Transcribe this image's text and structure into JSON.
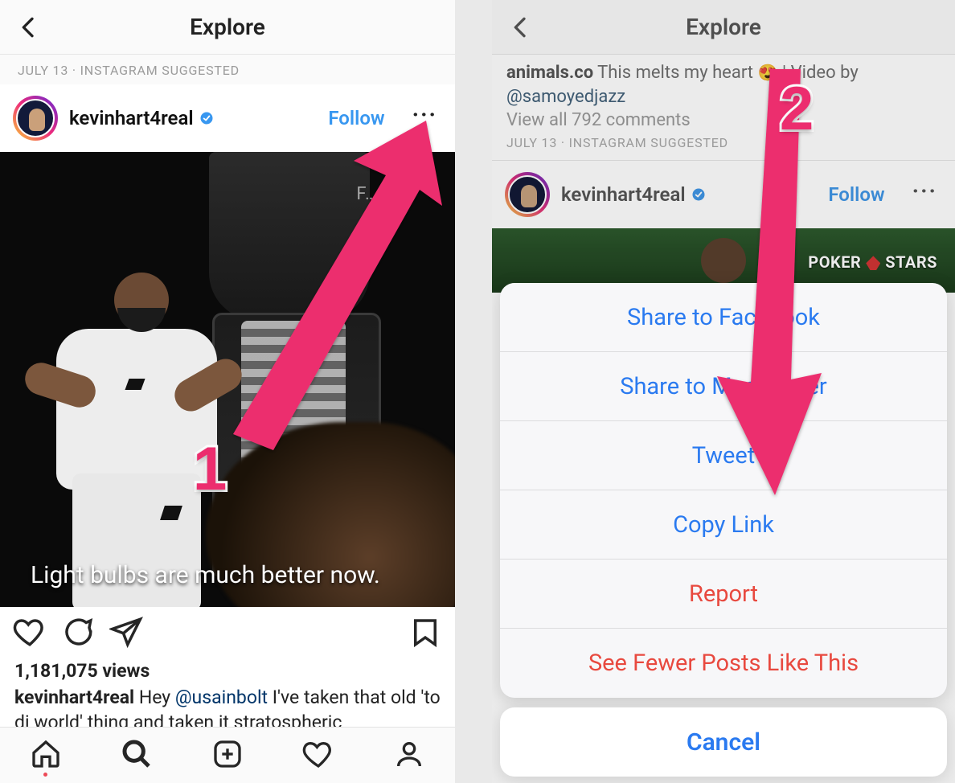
{
  "left": {
    "header_title": "Explore",
    "meta": "JULY 13 · INSTAGRAM SUGGESTED",
    "username": "kevinhart4real",
    "follow_label": "Follow",
    "video_top_tag": "F…  …S",
    "video_caption": "Light bulbs are much better now.",
    "view_count": "1,181,075 views",
    "caption_username": "kevinhart4real",
    "caption_text_pre": " Hey ",
    "caption_mention": "@usainbolt",
    "caption_text_post": " I've taken that old 'to di world' thing and taken it stratospheric"
  },
  "right": {
    "header_title": "Explore",
    "prev_username": "animals.co",
    "prev_text": " This melts my heart ",
    "prev_emoji": "😍",
    "prev_sep": " | Video by ",
    "prev_mention": "@samoyedjazz",
    "view_all": "View all 792 comments",
    "meta": "JULY 13 · INSTAGRAM SUGGESTED",
    "username": "kevinhart4real",
    "follow_label": "Follow",
    "brand_left": "POKER",
    "brand_right": "STARS",
    "sheet": {
      "share_fb": "Share to Facebook",
      "share_msg": "Share to Messenger",
      "tweet": "Tweet",
      "copy_link": "Copy Link",
      "report": "Report",
      "fewer": "See Fewer Posts Like This",
      "cancel": "Cancel"
    }
  },
  "steps": {
    "one": "1",
    "two": "2"
  }
}
